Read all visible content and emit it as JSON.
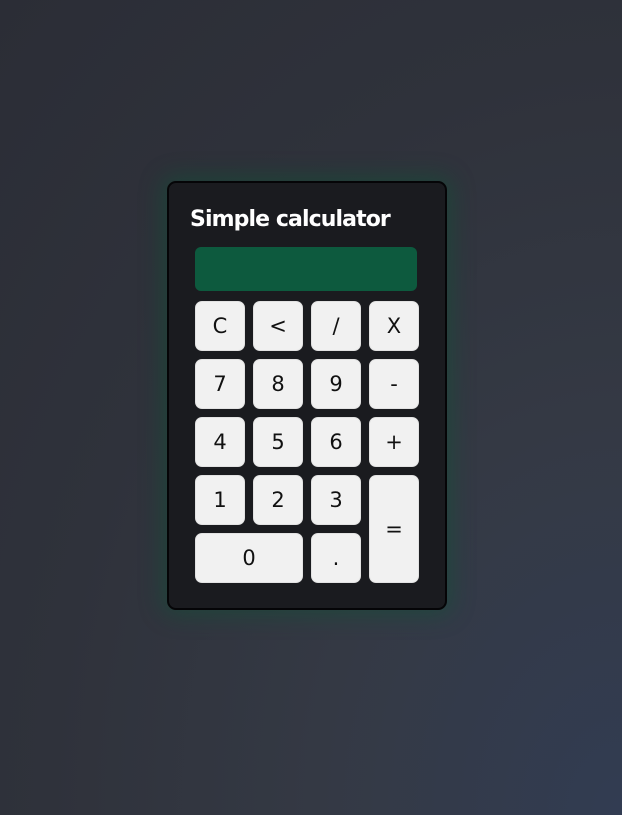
{
  "calculator": {
    "title": "Simple calculator",
    "display_value": "",
    "display_color": "#0d5a3e",
    "key_color": "#f1f1f1",
    "keys": {
      "clear": "C",
      "backspace": "<",
      "divide": "/",
      "multiply": "X",
      "seven": "7",
      "eight": "8",
      "nine": "9",
      "subtract": "-",
      "four": "4",
      "five": "5",
      "six": "6",
      "add": "+",
      "one": "1",
      "two": "2",
      "three": "3",
      "equals": "=",
      "zero": "0",
      "decimal": "."
    }
  }
}
